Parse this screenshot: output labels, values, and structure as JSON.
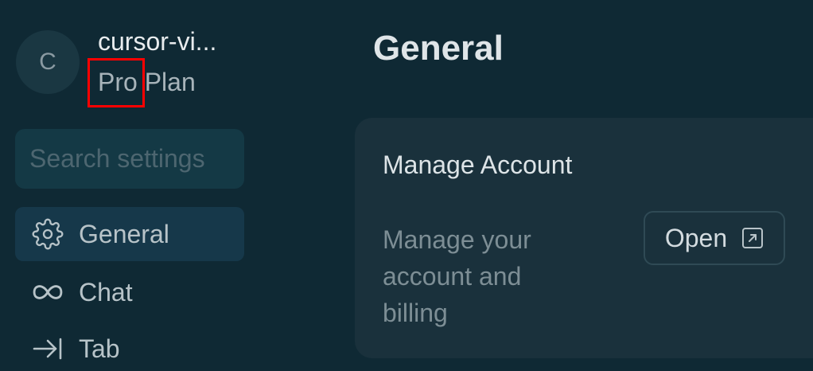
{
  "user": {
    "avatar_initial": "C",
    "name": "cursor-vi...",
    "plan_prefix": "Pro",
    "plan_suffix": " Plan"
  },
  "search": {
    "placeholder": "Search settings"
  },
  "sidebar": {
    "items": [
      {
        "label": "General",
        "icon": "gear-icon",
        "active": true
      },
      {
        "label": "Chat",
        "icon": "infinity-icon",
        "active": false
      },
      {
        "label": "Tab",
        "icon": "tab-arrow-icon",
        "active": false
      }
    ]
  },
  "main": {
    "title": "General",
    "card": {
      "title": "Manage Account",
      "description": "Manage your account and billing",
      "button_label": "Open",
      "button_icon": "external-link-icon"
    }
  },
  "colors": {
    "background": "#0f2934",
    "card": "#1a313c",
    "active_item": "#16384a",
    "highlight": "#ff0000"
  }
}
